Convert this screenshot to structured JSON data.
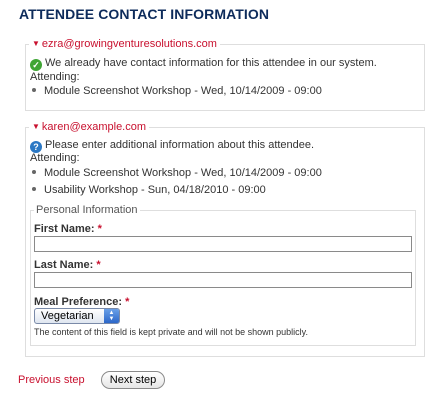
{
  "page_title": "ATTENDEE CONTACT INFORMATION",
  "attendees": [
    {
      "email": "ezra@growingventuresolutions.com",
      "status_icon": "checkmark-icon",
      "message": "We already have contact information for this attendee in our system.",
      "attending_label": "Attending:",
      "events": [
        "Module Screenshot Workshop - Wed, 10/14/2009 - 09:00"
      ]
    },
    {
      "email": "karen@example.com",
      "status_icon": "question-icon",
      "message": "Please enter additional information about this attendee.",
      "attending_label": "Attending:",
      "events": [
        "Module Screenshot Workshop - Wed, 10/14/2009 - 09:00",
        "Usability Workshop - Sun, 04/18/2010 - 09:00"
      ],
      "personal_info": {
        "legend": "Personal Information",
        "first_name_label": "First Name:",
        "first_name_value": "",
        "last_name_label": "Last Name:",
        "last_name_value": "",
        "meal_label": "Meal Preference:",
        "meal_value": "Vegetarian",
        "required_marker": "*",
        "meal_description": "The content of this field is kept private and will not be shown publicly."
      }
    }
  ],
  "nav": {
    "previous_label": "Previous step",
    "next_label": "Next step"
  },
  "colors": {
    "title": "#0d2b5b",
    "link": "#c8102e",
    "required": "#c8102e",
    "ok": "#3fa535",
    "help": "#2b78c4"
  }
}
